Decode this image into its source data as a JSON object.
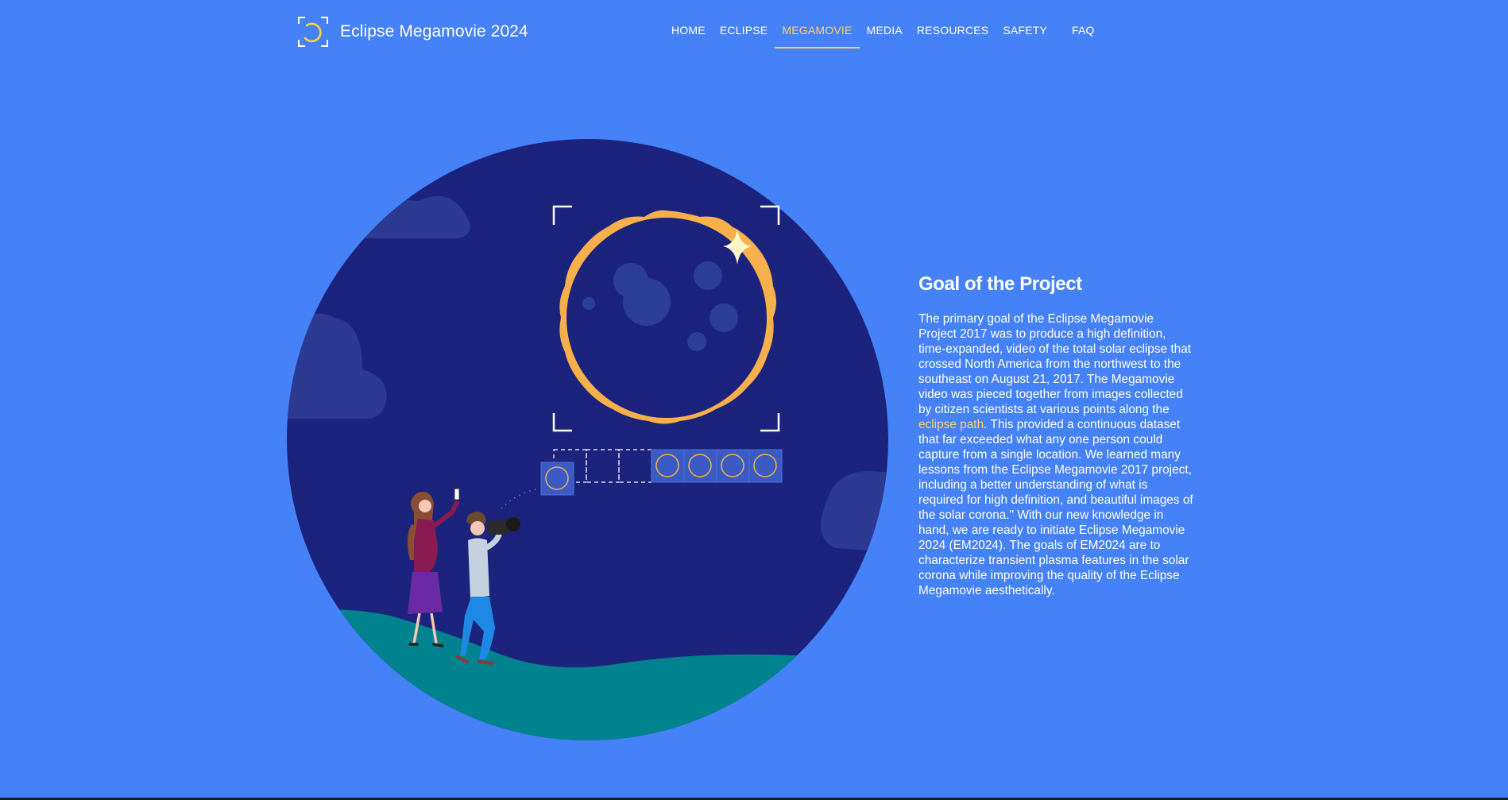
{
  "brand": {
    "title": "Eclipse Megamovie 2024",
    "logo_icon": "eclipse-logo-icon"
  },
  "nav": {
    "items": [
      {
        "label": "HOME",
        "active": false
      },
      {
        "label": "ECLIPSE",
        "active": false
      },
      {
        "label": "MEGAMOVIE",
        "active": true
      },
      {
        "label": "MEDIA",
        "active": false
      },
      {
        "label": "RESOURCES",
        "active": false
      },
      {
        "label": "SAFETY",
        "active": false
      },
      {
        "label": "FAQ",
        "active": false
      }
    ]
  },
  "main": {
    "heading": "Goal of the Project",
    "paragraph_before": "The primary goal of the Eclipse Megamovie Project 2017 was to produce a high definition, time-expanded, video of the total solar eclipse that crossed North America from the northwest to the southeast on August 21, 2017. The Megamovie video was pieced together from images collected by citizen scientists at various points along the ",
    "link_text": "eclipse path",
    "paragraph_after": ". This provided a continuous dataset that far exceeded what any one person could capture from a single location. We learned many lessons from the Eclipse Megamovie 2017 project, including a better understanding of what is required for high definition, and beautiful images of the solar corona.\" With our new knowledge in hand, we are ready to initiate Eclipse Megamovie 2024 (EM2024). The goals of EM2024 are to characterize transient plasma features in the solar corona while improving the quality of the Eclipse Megamovie aesthetically."
  },
  "colors": {
    "background": "#4582f7",
    "accent": "#ffd36b",
    "night_sky": "#1b237d",
    "corona": "#f7b04b",
    "ground": "#00838f"
  }
}
